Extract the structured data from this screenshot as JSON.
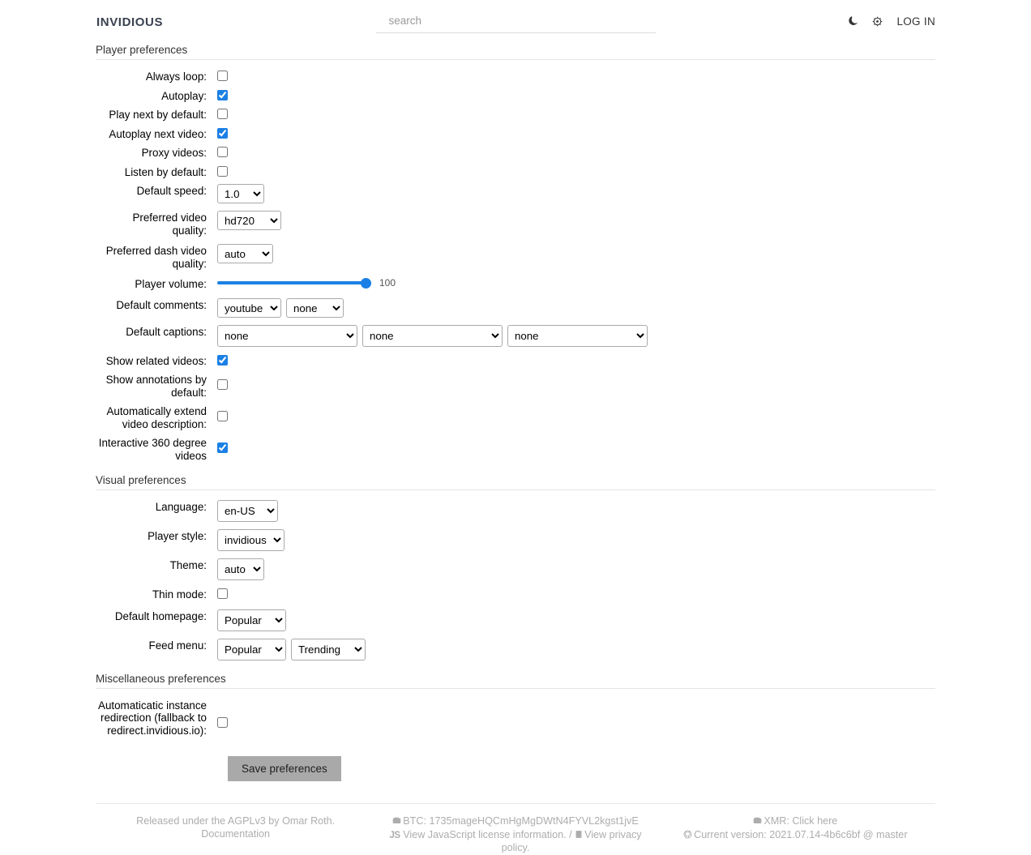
{
  "header": {
    "brand": "INVIDIOUS",
    "search_placeholder": "search",
    "search_value": "",
    "theme_toggle_icon": "moon-icon",
    "preferences_icon": "gear-icon",
    "login_label": "LOG IN"
  },
  "sections": {
    "player": {
      "legend": "Player preferences"
    },
    "visual": {
      "legend": "Visual preferences"
    },
    "misc": {
      "legend": "Miscellaneous preferences"
    }
  },
  "player": {
    "always_loop": {
      "label": "Always loop:",
      "checked": false
    },
    "autoplay": {
      "label": "Autoplay:",
      "checked": true
    },
    "play_next": {
      "label": "Play next by default:",
      "checked": false
    },
    "autoplay_next": {
      "label": "Autoplay next video:",
      "checked": true
    },
    "proxy_videos": {
      "label": "Proxy videos:",
      "checked": false
    },
    "listen_default": {
      "label": "Listen by default:",
      "checked": false
    },
    "default_speed": {
      "label": "Default speed:",
      "value": "1.0"
    },
    "preferred_quality": {
      "label": "Preferred video quality:",
      "value": "hd720"
    },
    "preferred_dash": {
      "label": "Preferred dash video quality:",
      "value": "auto"
    },
    "player_volume": {
      "label": "Player volume:",
      "value": "100",
      "min": "0",
      "max": "100"
    },
    "default_comments": {
      "label": "Default comments:",
      "value_1": "youtube",
      "value_2": "none"
    },
    "default_captions": {
      "label": "Default captions:",
      "value_1": "none",
      "value_2": "none",
      "value_3": "none"
    },
    "show_related": {
      "label": "Show related videos:",
      "checked": true
    },
    "show_annotations": {
      "label": "Show annotations by default:",
      "checked": false
    },
    "extend_description": {
      "label": "Automatically extend video description:",
      "checked": false
    },
    "interactive_360": {
      "label": "Interactive 360 degree videos",
      "checked": true
    }
  },
  "visual": {
    "language": {
      "label": "Language:",
      "value": "en-US"
    },
    "player_style": {
      "label": "Player style:",
      "value": "invidious"
    },
    "theme": {
      "label": "Theme:",
      "value": "auto"
    },
    "thin_mode": {
      "label": "Thin mode:",
      "checked": false
    },
    "default_homepage": {
      "label": "Default homepage:",
      "value": "Popular"
    },
    "feed_menu": {
      "label": "Feed menu:",
      "value_1": "Popular",
      "value_2": "Trending"
    }
  },
  "misc": {
    "auto_redirect": {
      "label": "Automaticatic instance redirection (fallback to redirect.invidious.io):",
      "checked": false
    }
  },
  "actions": {
    "save_label": "Save preferences"
  },
  "footer": {
    "left": {
      "license_text": "Released under the AGPLv3 by Omar Roth.",
      "documentation_label": "Documentation"
    },
    "center": {
      "btc_icon": "monero-wallet-icon",
      "btc_label": "BTC:",
      "btc_address": "1735mageHQCmHgMgDWtN4FYVL2kgst1jvE",
      "js_badge": "JS",
      "js_license_label": "View JavaScript license information.",
      "separator": "/",
      "privacy_icon": "document-icon",
      "privacy_label": "View privacy policy."
    },
    "right": {
      "xmr_icon": "monero-wallet-icon",
      "xmr_label": "XMR:",
      "xmr_link": "Click here",
      "github_icon": "github-icon",
      "version_text": "Current version: 2021.07.14-4b6c6bf @ master"
    }
  },
  "colors": {
    "accent": "#1b80e5",
    "brand": "#3a4150",
    "button_bg": "#a9a9a9",
    "footer_text": "#adadad"
  }
}
